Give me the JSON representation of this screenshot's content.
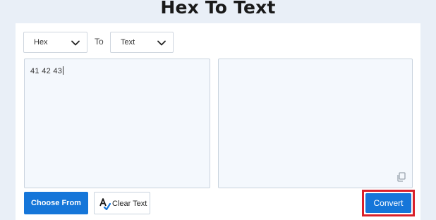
{
  "page": {
    "title": "Hex To Text"
  },
  "converter": {
    "from_select": {
      "selected": "Hex",
      "icon": "chevron-down-icon"
    },
    "to_label": "To",
    "to_select": {
      "selected": "Text",
      "icon": "chevron-down-icon"
    },
    "input": {
      "value": "41 42 43"
    },
    "output": {
      "value": "",
      "copy_icon": "copy-icon"
    }
  },
  "actions": {
    "choose_from_label": "Choose From",
    "clear_text_label": "Clear Text",
    "clear_icon": "spell-check-icon",
    "convert_label": "Convert"
  },
  "colors": {
    "accent": "#1576d9",
    "highlight_border": "#d9202a",
    "page_bg": "#e9eff7",
    "textarea_bg": "#f4f8fd"
  }
}
